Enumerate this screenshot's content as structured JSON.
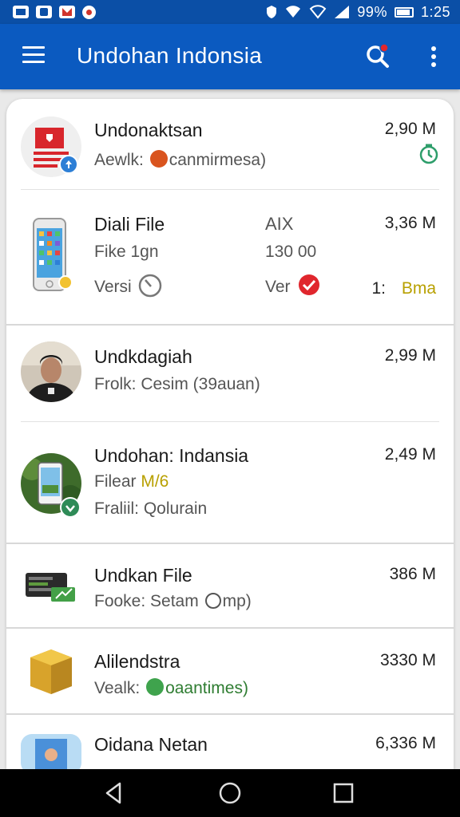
{
  "status_bar": {
    "battery_text": "99%",
    "time": "1:25"
  },
  "app_bar": {
    "title": "Undohan Indonsia"
  },
  "items": [
    {
      "name": "Undonaktsan",
      "size": "2,90 M",
      "sub_label": "Aewlk:",
      "sub_value": "canmirmesa)"
    },
    {
      "name": "Diali File",
      "size": "3,36 M",
      "col2_header": "AIX",
      "sub_label": "Fike 1gn",
      "col2_value": "130 00",
      "ver_label_1": "Versi",
      "ver_label_2": "Ver",
      "extra_prefix": "1:",
      "extra_value": "Bma"
    },
    {
      "name": "Undkdagiah",
      "size": "2,99 M",
      "sub_label": "Frolk: Cesim (39auan)"
    },
    {
      "name": "Undohan: Indansia",
      "size": "2,49 M",
      "sub_label": "Filear",
      "sub_value": "M/6",
      "sub_label_2": "Fraliil: Qolurain"
    },
    {
      "name": "Undkan File",
      "size": "386 M",
      "sub_label": "Fooke: Setam",
      "sub_value": "mp)"
    },
    {
      "name": "Alilendstra",
      "size": "3330 M",
      "sub_label": "Vealk:",
      "sub_value": "oaantimes)"
    },
    {
      "name": "Oidana Netan",
      "size": "6,336 M"
    }
  ],
  "icons": {
    "menu": "menu-icon",
    "search": "search-icon",
    "more": "more-vert-icon",
    "back": "back-triangle-icon",
    "home": "home-circle-icon",
    "recents": "recents-square-icon"
  },
  "colors": {
    "primary": "#0b5ac0",
    "status_bar": "#0b4fa6",
    "accent_red": "#e0262d",
    "accent_green": "#2e8b57",
    "accent_yellow": "#b8a000"
  }
}
